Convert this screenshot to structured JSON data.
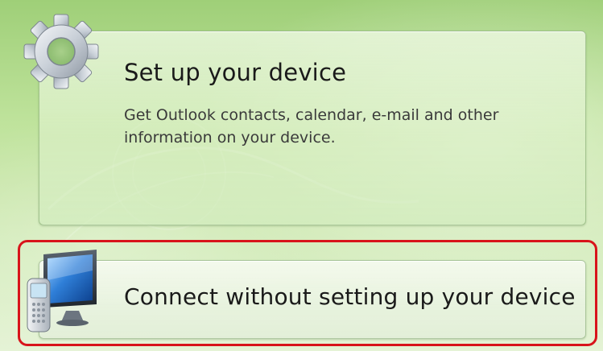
{
  "options": {
    "setup": {
      "title": "Set up your device",
      "description": "Get Outlook contacts, calendar, e-mail and other information on your device.",
      "icon": "gear-icon"
    },
    "connect": {
      "title": "Connect without setting up your device",
      "icon": "device-icon"
    }
  },
  "colors": {
    "highlight": "#d8141b",
    "background": "#bfe39c"
  }
}
